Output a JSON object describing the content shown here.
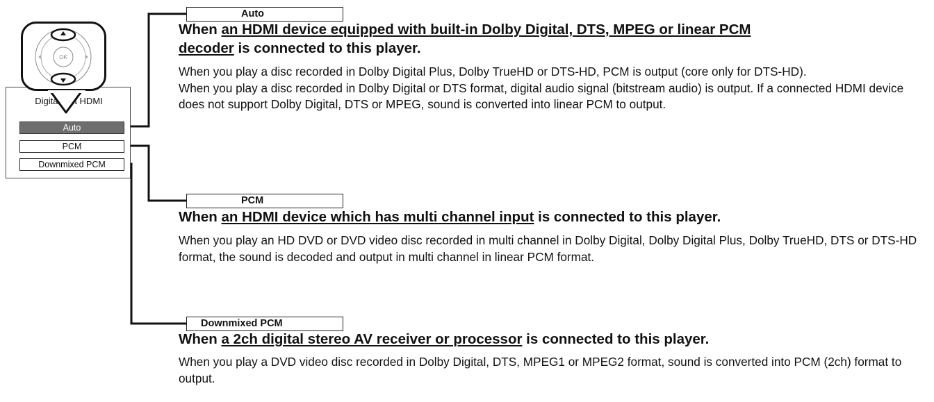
{
  "menu": {
    "title": "Digital Out HDMI",
    "items": [
      {
        "label": "Auto",
        "selected": true
      },
      {
        "label": "PCM",
        "selected": false
      },
      {
        "label": "Downmixed PCM",
        "selected": false
      }
    ]
  },
  "remote": {
    "center_label": "OK",
    "icon": "remote-dpad-icon"
  },
  "colors": {
    "selected_fill": "#6e6e6e",
    "line": "#111111"
  },
  "sections": [
    {
      "label": "Auto",
      "heading_prefix": "When ",
      "heading_link": "an HDMI device equipped with built-in Dolby Digital, DTS, MPEG or linear PCM",
      "heading_link2": "decoder",
      "heading_suffix": " is connected to this player.",
      "paragraphs": [
        "When you play a disc recorded in Dolby Digital Plus, Dolby TrueHD or DTS-HD, PCM is output (core only for DTS-HD).",
        "When you play a disc recorded in Dolby Digital or DTS format, digital audio signal (bitstream audio) is output. If a connected HDMI device does not support Dolby Digital, DTS or MPEG, sound is converted into linear PCM to output."
      ]
    },
    {
      "label": "PCM",
      "heading_prefix": "When ",
      "heading_link": "an HDMI device which has multi channel input",
      "heading_suffix": " is connected to this player.",
      "paragraphs": [
        "When you play an HD DVD or DVD video disc recorded in multi channel in Dolby Digital, Dolby Digital Plus, Dolby TrueHD, DTS or DTS-HD format, the sound is decoded and output in multi channel in linear PCM format."
      ]
    },
    {
      "label": "Downmixed PCM",
      "heading_prefix": "When ",
      "heading_link": "a 2ch digital stereo AV receiver or processor",
      "heading_suffix": " is connected to this player.",
      "paragraphs": [
        "When you play a DVD video disc recorded in Dolby Digital, DTS, MPEG1 or MPEG2 format, sound is converted into PCM (2ch) format to output."
      ]
    }
  ]
}
